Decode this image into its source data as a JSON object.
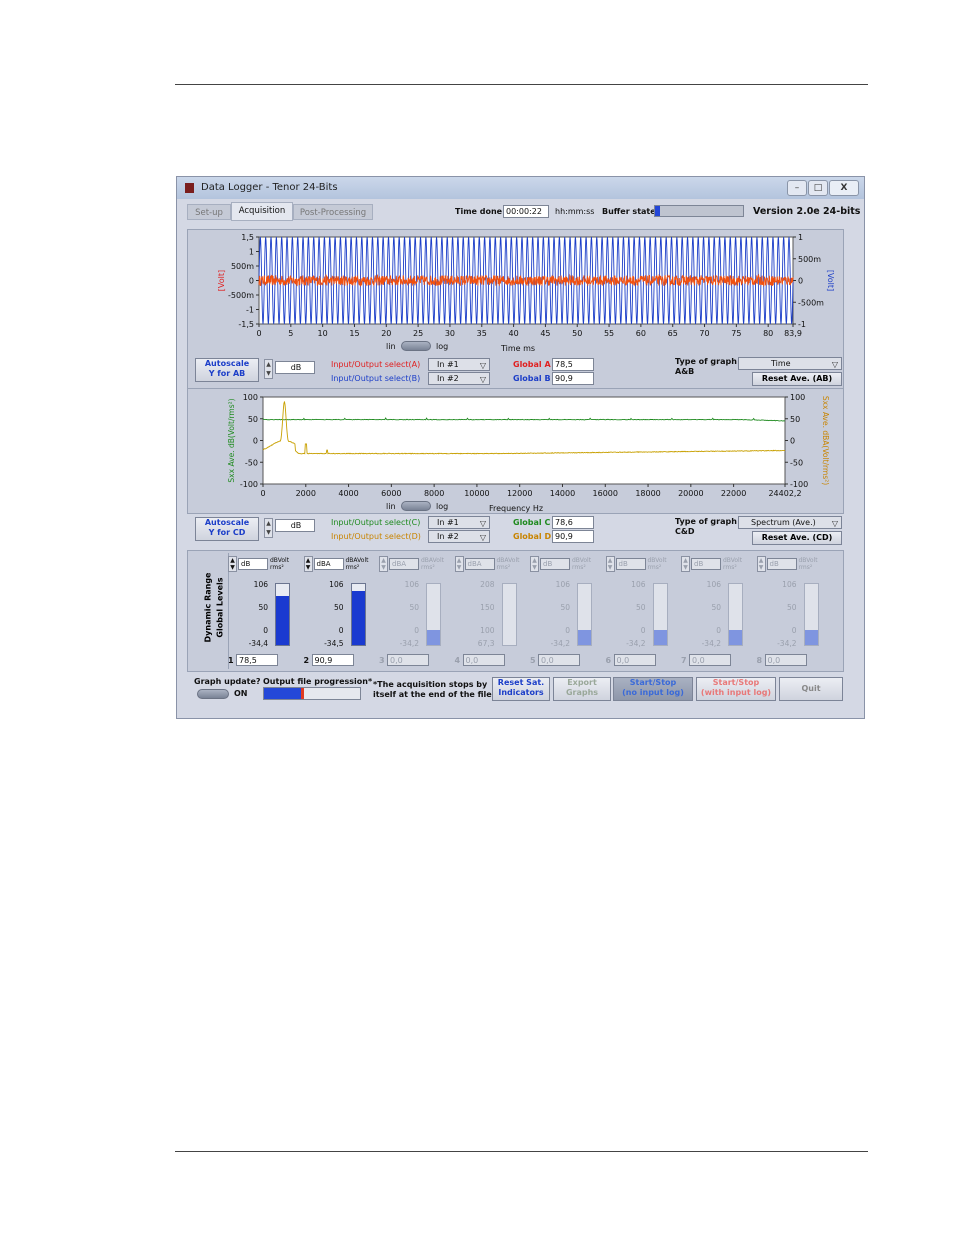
{
  "window": {
    "title": "Data Logger - Tenor 24-Bits",
    "minimize": "–",
    "maximize": "□",
    "close": "X"
  },
  "tabs": [
    {
      "label": "Set-up",
      "active": false
    },
    {
      "label": "Acquisition",
      "active": true
    },
    {
      "label": "Post-Processing",
      "active": false
    }
  ],
  "header": {
    "time_done_label": "Time done",
    "time_done_value": "00:00:22",
    "time_format": "hh:mm:ss",
    "buffer_state_label": "Buffer state",
    "buffer_state_fraction": 0.06,
    "version": "Version 2.0e 24-bits"
  },
  "graph_ab": {
    "chart_data": {
      "type": "line",
      "x_axis_label": "Time ms",
      "x_ticks": [
        "0",
        "5",
        "10",
        "15",
        "20",
        "25",
        "30",
        "35",
        "40",
        "45",
        "50",
        "55",
        "60",
        "65",
        "70",
        "75",
        "80",
        "83,9"
      ],
      "x_range": [
        0,
        83.9
      ],
      "y_left_label": "[Volt]",
      "y_left_ticks": [
        "1,5",
        "1",
        "500m",
        "0",
        "-500m",
        "-1",
        "-1,5"
      ],
      "y_left_range": [
        -1.5,
        1.5
      ],
      "y_right_label": "[Volt]",
      "y_right_ticks": [
        "1",
        "500m",
        "0",
        "-500m",
        "-1"
      ],
      "y_right_range": [
        -1,
        1
      ],
      "series": [
        {
          "axis": "right",
          "color": "#1c3ec8",
          "kind": "sine",
          "amplitude": 1.0,
          "cycles": 100
        },
        {
          "axis": "left",
          "color": "#f05010",
          "kind": "noise",
          "amplitude": 0.2
        }
      ]
    },
    "lin": "lin",
    "log": "log"
  },
  "controls_ab": {
    "autoscale": "Autoscale\nY for AB",
    "unit": "dB",
    "io_a_label": "Input/Output select(A)",
    "io_a_value": "In #1",
    "io_b_label": "Input/Output select(B)",
    "io_b_value": "In #2",
    "global_a_label": "Global A",
    "global_a_value": "78,5",
    "global_b_label": "Global B",
    "global_b_value": "90,9",
    "type_label": "Type of graph\nA&B",
    "type_value": "Time",
    "reset": "Reset Ave. (AB)"
  },
  "graph_cd": {
    "chart_data": {
      "type": "line",
      "x_axis_label": "Frequency Hz",
      "x_ticks": [
        "0",
        "2000",
        "4000",
        "6000",
        "8000",
        "10000",
        "12000",
        "14000",
        "16000",
        "18000",
        "20000",
        "22000",
        "24402,2"
      ],
      "x_range": [
        0,
        24402.2
      ],
      "y_left_label": "Sxx Ave. dB(Volt/rms²)",
      "y_left_ticks": [
        "100",
        "50",
        "0",
        "-50",
        "-100"
      ],
      "y_left_range": [
        -100,
        100
      ],
      "y_right_label": "Sxx Ave. dBA(Volt/rms²)",
      "y_right_ticks": [
        "100",
        "50",
        "0",
        "-50",
        "-100"
      ],
      "y_right_range": [
        -100,
        100
      ],
      "series": [
        {
          "color": "#1f8a1f",
          "kind": "flat",
          "level": 48
        },
        {
          "color": "#c8a000",
          "kind": "spectrum",
          "peak_freq": 1000,
          "peak_level": 90
        }
      ]
    },
    "lin": "lin",
    "log": "log"
  },
  "controls_cd": {
    "autoscale": "Autoscale\nY for CD",
    "unit": "dB",
    "io_c_label": "Input/Output select(C)",
    "io_c_value": "In #1",
    "io_d_label": "Input/Output select(D)",
    "io_d_value": "In #2",
    "global_c_label": "Global C",
    "global_c_value": "78,6",
    "global_d_label": "Global D",
    "global_d_value": "90,9",
    "type_label": "Type of graph\nC&D",
    "type_value": "Spectrum (Ave.)",
    "reset": "Reset Ave. (CD)"
  },
  "levels": {
    "side_label_1": "Dynamic Range",
    "side_label_2": "Global Levels",
    "channels": [
      {
        "n": "1",
        "unit": "dB",
        "unit2": "dBVolt rms²",
        "ticks": [
          "106",
          "50",
          "0",
          "-34,4"
        ],
        "value": "78,5",
        "fill": 0.8,
        "enabled": true
      },
      {
        "n": "2",
        "unit": "dBA",
        "unit2": "dBAVolt rms²",
        "ticks": [
          "106",
          "50",
          "0",
          "-34,5"
        ],
        "value": "90,9",
        "fill": 0.89,
        "enabled": true
      },
      {
        "n": "3",
        "unit": "dBA",
        "unit2": "dBAVolt rms²",
        "ticks": [
          "106",
          "50",
          "0",
          "-34,2"
        ],
        "value": "0,0",
        "fill": 0.24,
        "enabled": false
      },
      {
        "n": "4",
        "unit": "dBA",
        "unit2": "dBAVolt rms²",
        "ticks": [
          "208",
          "150",
          "100",
          "67,3"
        ],
        "value": "0,0",
        "fill": 0.0,
        "enabled": false
      },
      {
        "n": "5",
        "unit": "dB",
        "unit2": "dBVolt rms²",
        "ticks": [
          "106",
          "50",
          "0",
          "-34,2"
        ],
        "value": "0,0",
        "fill": 0.24,
        "enabled": false
      },
      {
        "n": "6",
        "unit": "dB",
        "unit2": "dBVolt rms²",
        "ticks": [
          "106",
          "50",
          "0",
          "-34,2"
        ],
        "value": "0,0",
        "fill": 0.24,
        "enabled": false
      },
      {
        "n": "7",
        "unit": "dB",
        "unit2": "dBVolt rms²",
        "ticks": [
          "106",
          "50",
          "0",
          "-34,2"
        ],
        "value": "0,0",
        "fill": 0.24,
        "enabled": false
      },
      {
        "n": "8",
        "unit": "dB",
        "unit2": "dBVolt rms²",
        "ticks": [
          "106",
          "50",
          "0",
          "-34,2"
        ],
        "value": "0,0",
        "fill": 0.24,
        "enabled": false
      }
    ]
  },
  "bottom": {
    "graph_update": "Graph update?",
    "on": "ON",
    "output_progress": "Output file progression*",
    "output_progress_fraction": 0.42,
    "note": "*The acquisition stops by\nitself at the end of the file.",
    "reset_sat": "Reset Sat.\nIndicators",
    "export": "Export\nGraphs",
    "start_no_log": "Start/Stop\n(no input log)",
    "start_with_log": "Start/Stop\n(with input log)",
    "quit": "Quit"
  },
  "colors": {
    "accent_blue": "#1c3ec8",
    "red": "#e02020",
    "green": "#1f8a1f",
    "orange": "#c88400",
    "meter": "#1a3ad0",
    "meter_disabled": "#7f95e0"
  }
}
